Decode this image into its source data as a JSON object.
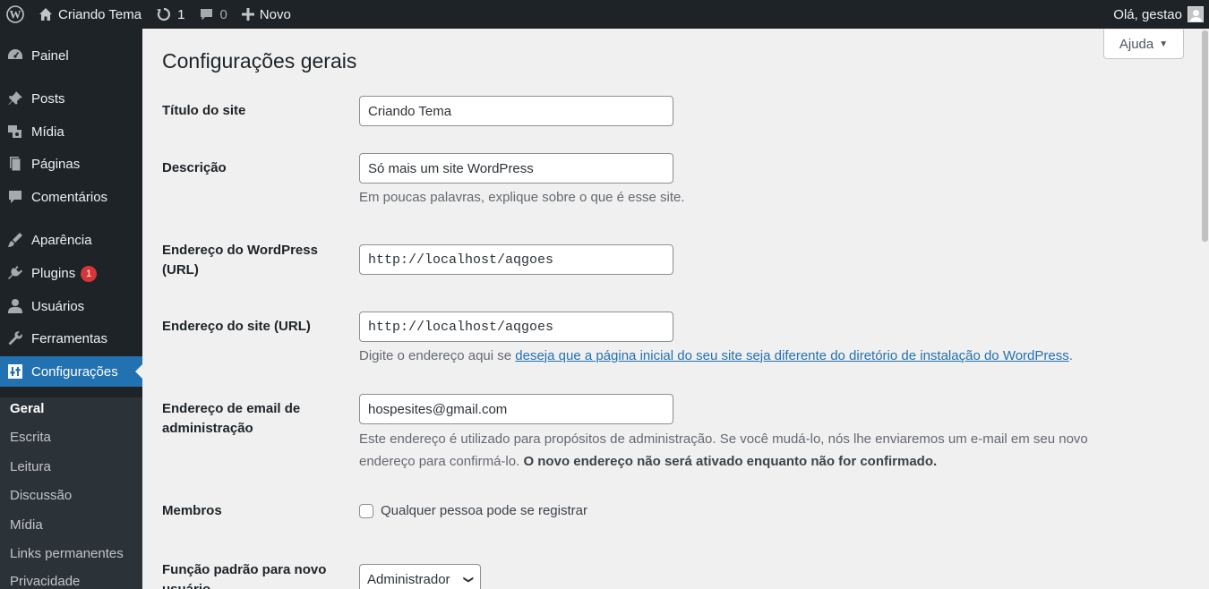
{
  "admin_bar": {
    "site_name": "Criando Tema",
    "updates_count": "1",
    "comments_count": "0",
    "new_label": "Novo",
    "greeting": "Olá, gestao"
  },
  "sidebar": {
    "items": [
      {
        "label": "Painel",
        "icon": "dashboard-icon"
      },
      {
        "label": "Posts",
        "icon": "pin-icon"
      },
      {
        "label": "Mídia",
        "icon": "media-icon"
      },
      {
        "label": "Páginas",
        "icon": "pages-icon"
      },
      {
        "label": "Comentários",
        "icon": "comments-icon"
      },
      {
        "label": "Aparência",
        "icon": "appearance-icon"
      },
      {
        "label": "Plugins",
        "icon": "plugins-icon",
        "badge": "1"
      },
      {
        "label": "Usuários",
        "icon": "users-icon"
      },
      {
        "label": "Ferramentas",
        "icon": "tools-icon"
      },
      {
        "label": "Configurações",
        "icon": "settings-icon"
      }
    ],
    "submenu": [
      "Geral",
      "Escrita",
      "Leitura",
      "Discussão",
      "Mídia",
      "Links permanentes",
      "Privacidade"
    ]
  },
  "help_label": "Ajuda",
  "page_title": "Configurações gerais",
  "form": {
    "site_title": {
      "label": "Título do site",
      "value": "Criando Tema"
    },
    "tagline": {
      "label": "Descrição",
      "value": "Só mais um site WordPress",
      "description": "Em poucas palavras, explique sobre o que é esse site."
    },
    "wp_url": {
      "label": "Endereço do WordPress (URL)",
      "value": "http://localhost/aqgoes"
    },
    "site_url": {
      "label": "Endereço do site (URL)",
      "value": "http://localhost/aqgoes",
      "description_prefix": "Digite o endereço aqui se ",
      "description_link": "deseja que a página inicial do seu site seja diferente do diretório de instalação do WordPress",
      "description_suffix": "."
    },
    "admin_email": {
      "label": "Endereço de email de administração",
      "value": "hospesites@gmail.com",
      "description": "Este endereço é utilizado para propósitos de administração. Se você mudá-lo, nós lhe enviaremos um e-mail em seu novo endereço para confirmá-lo. ",
      "description_bold": "O novo endereço não será ativado enquanto não for confirmado."
    },
    "membership": {
      "label": "Membros",
      "checkbox_label": "Qualquer pessoa pode se registrar",
      "checked": false
    },
    "default_role": {
      "label": "Função padrão para novo usuário",
      "value": "Administrador"
    }
  },
  "colors": {
    "admin_dark": "#1d2327",
    "accent": "#2271b1",
    "badge": "#d63638"
  }
}
